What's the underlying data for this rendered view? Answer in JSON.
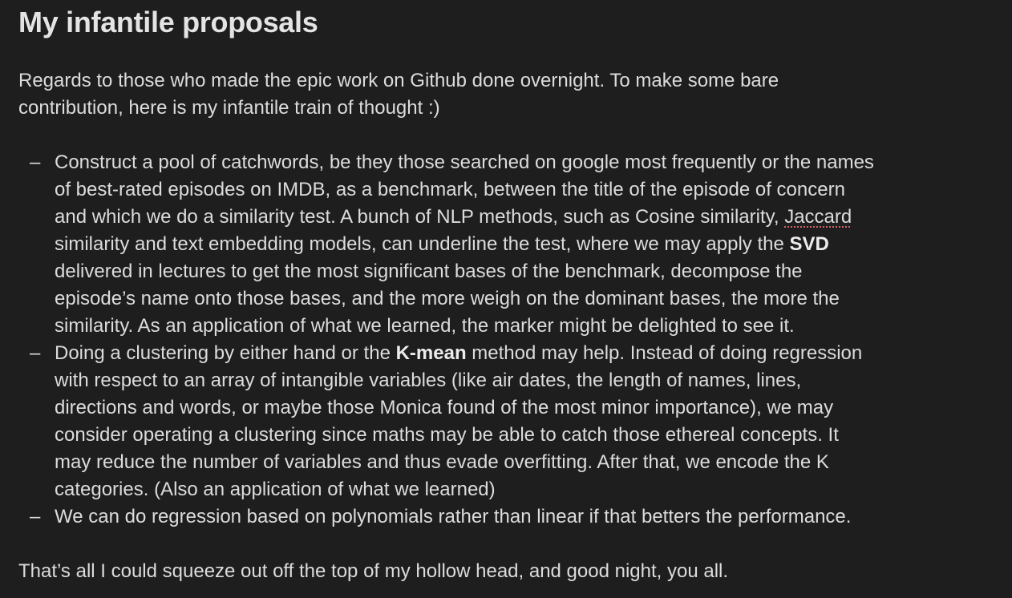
{
  "title": "My infantile proposals",
  "intro": {
    "lines": [
      "Regards to those who made the epic work on Github done overnight. To make some bare",
      "contribution, here is my infantile train of thought :)"
    ]
  },
  "bullet_marker": "–",
  "list": {
    "item1": {
      "l1": "Construct a pool of catchwords, be they those searched on google most frequently or the names",
      "l2": "of best-rated episodes on IMDB, as a benchmark, between the title of the episode of concern",
      "l3_pre": "and which we do a similarity test. A bunch of NLP methods, such as Cosine similarity, ",
      "l3_flagged": "Jaccard",
      "l4_pre": "similarity and text embedding models, can underline the test, where we may apply the ",
      "l4_bold": "SVD",
      "l5": "delivered in lectures to get the most significant bases of the benchmark, decompose the",
      "l6": "episode’s name onto those bases, and the more weigh on the dominant bases, the more the",
      "l7": "similarity. As an application of what we learned, the marker might be delighted to see it."
    },
    "item2": {
      "l1_pre": "Doing a clustering by either hand or the ",
      "l1_bold": "K-mean",
      "l1_post": " method may help. Instead of doing regression",
      "l2": "with respect to an array of intangible variables (like air dates, the length of names, lines,",
      "l3": "directions and words, or maybe those Monica found of the most minor importance), we may",
      "l4": "consider operating a clustering since maths may be able to catch those ethereal concepts. It",
      "l5": "may reduce the number of variables and thus evade overfitting. After that, we encode the K",
      "l6": "categories. (Also an application of what we learned)"
    },
    "item3": {
      "l1": "We can do regression based on polynomials rather than linear if that betters the performance."
    }
  },
  "outro": "That’s all I could squeeze out off the top of my hollow head, and good night, you all."
}
